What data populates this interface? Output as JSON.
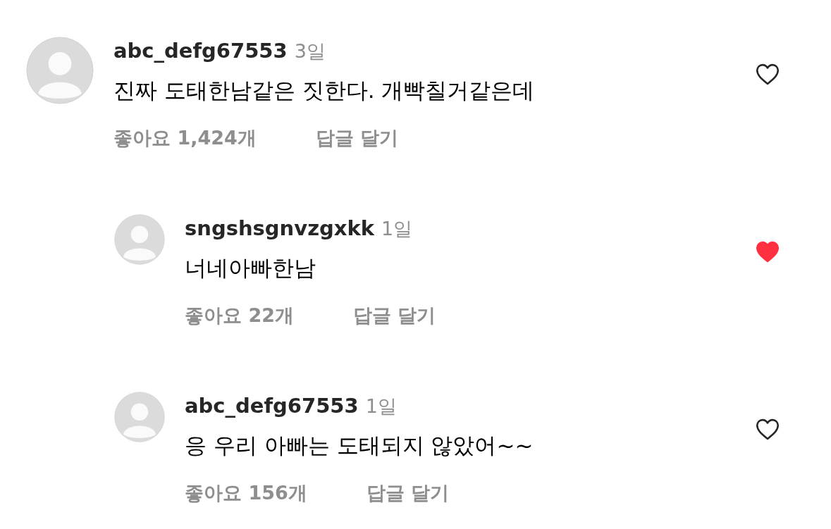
{
  "comments": [
    {
      "username": "abc_defg67553",
      "time": "3일",
      "text": "진짜 도태한남같은 짓한다. 개빡칠거같은데",
      "likes": "좋아요 1,424개",
      "reply_label": "답글 달기",
      "liked": false,
      "replies": [
        {
          "username": "sngshsgnvzgxkk",
          "time": "1일",
          "text": "너네아빠한남",
          "likes": "좋아요 22개",
          "reply_label": "답글 달기",
          "liked": true
        },
        {
          "username": "abc_defg67553",
          "time": "1일",
          "text": "응 우리 아빠는 도태되지 않았어~~",
          "likes": "좋아요 156개",
          "reply_label": "답글 달기",
          "liked": false
        }
      ]
    }
  ]
}
